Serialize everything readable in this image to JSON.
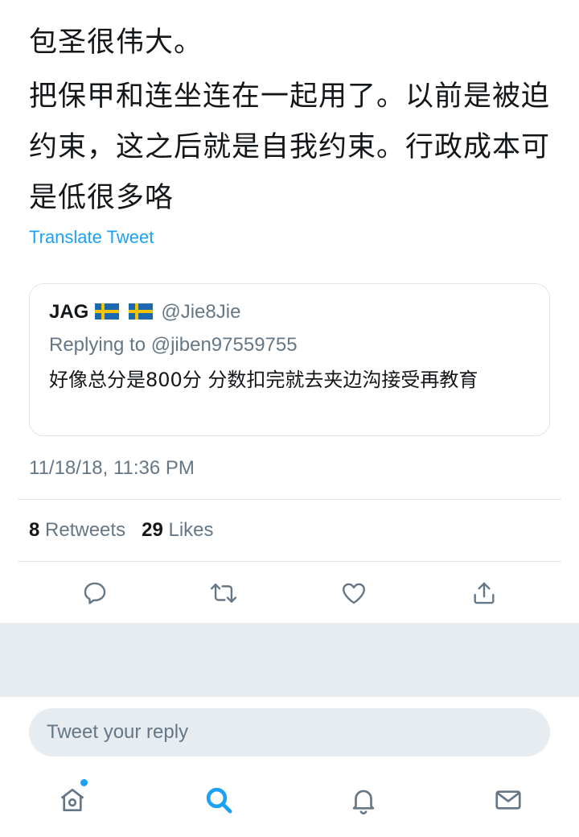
{
  "tweet": {
    "lines": [
      "包圣很伟大。",
      "把保甲和连坐连在一起用了。以前是被迫约束，这之后就是自我约束。行政成本可是低很多咯"
    ],
    "translate_label": "Translate Tweet",
    "timestamp": "11/18/18, 11:36 PM"
  },
  "quoted": {
    "name": "JAG",
    "handle": "@Jie8Jie",
    "replying_to": "Replying to @jiben97559755",
    "text": "好像总分是800分 分数扣完就去夹边沟接受再教育"
  },
  "stats": {
    "retweets_count": "8",
    "retweets_label": "Retweets",
    "likes_count": "29",
    "likes_label": "Likes"
  },
  "actions": [
    "reply-icon",
    "retweet-icon",
    "like-icon",
    "share-icon"
  ],
  "reply": {
    "placeholder": "Tweet your reply"
  },
  "tabbar": [
    "home-icon",
    "search-icon",
    "notifications-icon",
    "messages-icon"
  ],
  "colors": {
    "accent": "#1da1f2",
    "text": "#14171a",
    "muted": "#657786",
    "border": "#e1e8ed",
    "band": "#e6ecf0"
  }
}
